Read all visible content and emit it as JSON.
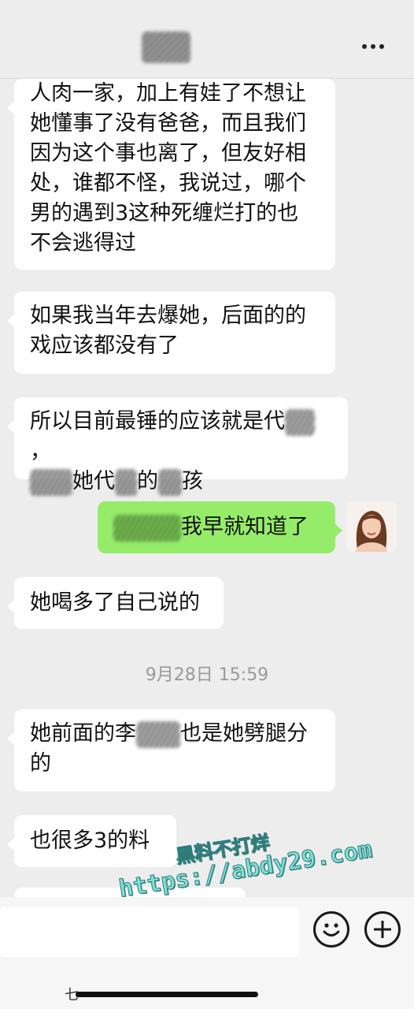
{
  "header": {
    "more_icon": "more-dots-icon"
  },
  "messages": [
    {
      "side": "left",
      "lines": [
        "人肉一家，加上有娃了不想让",
        "她懂事了没有爸爸，而且我们",
        "因为这个事也离了，但友好相",
        "处，谁都不怪，我说过，哪个",
        "男的遇到3这种死缠烂打的也",
        "不会逃得过"
      ]
    },
    {
      "side": "left",
      "lines": [
        "如果我当年去爆她，后面的的",
        "戏应该都没有了"
      ]
    },
    {
      "side": "left",
      "segments": [
        "所以目前最锤的应该就是代",
        "，",
        "她代",
        "的",
        "孩"
      ]
    },
    {
      "side": "right",
      "text": "我早就知道了"
    },
    {
      "side": "left",
      "text": "她喝多了自己说的"
    },
    {
      "side": "left",
      "segments": [
        "她前面的李",
        "也是她劈腿分",
        "的"
      ]
    },
    {
      "side": "left",
      "text": "也很多3的料"
    }
  ],
  "timestamp": "9月28日 15:59",
  "watermark": {
    "line1": "黑料不打烊",
    "line2": "https://abdy29.com"
  },
  "input_bar": {
    "emoji_icon": "emoji-face-icon",
    "plus_icon": "plus-circle-icon",
    "partial_text": "七"
  },
  "colors": {
    "background": "#ededed",
    "bubble_left": "#ffffff",
    "bubble_right": "#95ec69"
  }
}
